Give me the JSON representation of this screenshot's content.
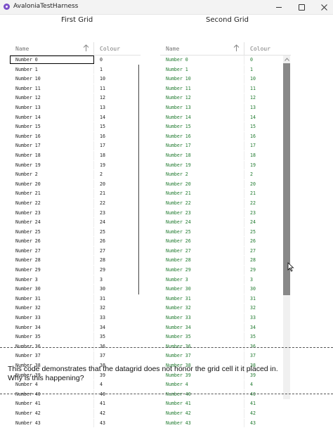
{
  "window": {
    "title": "AvaloniaTestHarness"
  },
  "grid1": {
    "title": "First Grid",
    "header": {
      "name": "Name",
      "colour": "Colour"
    },
    "rows": [
      {
        "name": "Number 0",
        "colour": "0"
      },
      {
        "name": "Number 1",
        "colour": "1"
      },
      {
        "name": "Number 10",
        "colour": "10"
      },
      {
        "name": "Number 11",
        "colour": "11"
      },
      {
        "name": "Number 12",
        "colour": "12"
      },
      {
        "name": "Number 13",
        "colour": "13"
      },
      {
        "name": "Number 14",
        "colour": "14"
      },
      {
        "name": "Number 15",
        "colour": "15"
      },
      {
        "name": "Number 16",
        "colour": "16"
      },
      {
        "name": "Number 17",
        "colour": "17"
      },
      {
        "name": "Number 18",
        "colour": "18"
      },
      {
        "name": "Number 19",
        "colour": "19"
      },
      {
        "name": "Number 2",
        "colour": "2"
      },
      {
        "name": "Number 20",
        "colour": "20"
      },
      {
        "name": "Number 21",
        "colour": "21"
      },
      {
        "name": "Number 22",
        "colour": "22"
      },
      {
        "name": "Number 23",
        "colour": "23"
      },
      {
        "name": "Number 24",
        "colour": "24"
      },
      {
        "name": "Number 25",
        "colour": "25"
      },
      {
        "name": "Number 26",
        "colour": "26"
      },
      {
        "name": "Number 27",
        "colour": "27"
      },
      {
        "name": "Number 28",
        "colour": "28"
      },
      {
        "name": "Number 29",
        "colour": "29"
      },
      {
        "name": "Number 3",
        "colour": "3"
      },
      {
        "name": "Number 30",
        "colour": "30"
      },
      {
        "name": "Number 31",
        "colour": "31"
      },
      {
        "name": "Number 32",
        "colour": "32"
      },
      {
        "name": "Number 33",
        "colour": "33"
      },
      {
        "name": "Number 34",
        "colour": "34"
      },
      {
        "name": "Number 35",
        "colour": "35"
      },
      {
        "name": "Number 36",
        "colour": "36"
      },
      {
        "name": "Number 37",
        "colour": "37"
      },
      {
        "name": "Number 38",
        "colour": "38"
      },
      {
        "name": "Number 39",
        "colour": "39"
      },
      {
        "name": "Number 4",
        "colour": "4"
      },
      {
        "name": "Number 40",
        "colour": "40"
      },
      {
        "name": "Number 41",
        "colour": "41"
      },
      {
        "name": "Number 42",
        "colour": "42"
      },
      {
        "name": "Number 43",
        "colour": "43"
      }
    ]
  },
  "grid2": {
    "title": "Second Grid",
    "header": {
      "name": "Name",
      "colour": "Colour"
    },
    "rows": [
      {
        "name": "Number 0",
        "colour": "0"
      },
      {
        "name": "Number 1",
        "colour": "1"
      },
      {
        "name": "Number 10",
        "colour": "10"
      },
      {
        "name": "Number 11",
        "colour": "11"
      },
      {
        "name": "Number 12",
        "colour": "12"
      },
      {
        "name": "Number 13",
        "colour": "13"
      },
      {
        "name": "Number 14",
        "colour": "14"
      },
      {
        "name": "Number 15",
        "colour": "15"
      },
      {
        "name": "Number 16",
        "colour": "16"
      },
      {
        "name": "Number 17",
        "colour": "17"
      },
      {
        "name": "Number 18",
        "colour": "18"
      },
      {
        "name": "Number 19",
        "colour": "19"
      },
      {
        "name": "Number 2",
        "colour": "2"
      },
      {
        "name": "Number 20",
        "colour": "20"
      },
      {
        "name": "Number 21",
        "colour": "21"
      },
      {
        "name": "Number 22",
        "colour": "22"
      },
      {
        "name": "Number 23",
        "colour": "23"
      },
      {
        "name": "Number 24",
        "colour": "24"
      },
      {
        "name": "Number 25",
        "colour": "25"
      },
      {
        "name": "Number 26",
        "colour": "26"
      },
      {
        "name": "Number 27",
        "colour": "27"
      },
      {
        "name": "Number 28",
        "colour": "28"
      },
      {
        "name": "Number 29",
        "colour": "29"
      },
      {
        "name": "Number 3",
        "colour": "3"
      },
      {
        "name": "Number 30",
        "colour": "30"
      },
      {
        "name": "Number 31",
        "colour": "31"
      },
      {
        "name": "Number 32",
        "colour": "32"
      },
      {
        "name": "Number 33",
        "colour": "33"
      },
      {
        "name": "Number 34",
        "colour": "34"
      },
      {
        "name": "Number 35",
        "colour": "35"
      },
      {
        "name": "Number 36",
        "colour": "36"
      },
      {
        "name": "Number 37",
        "colour": "37"
      },
      {
        "name": "Number 38",
        "colour": "38"
      },
      {
        "name": "Number 39",
        "colour": "39"
      },
      {
        "name": "Number 4",
        "colour": "4"
      },
      {
        "name": "Number 40",
        "colour": "40"
      },
      {
        "name": "Number 41",
        "colour": "41"
      },
      {
        "name": "Number 42",
        "colour": "42"
      },
      {
        "name": "Number 43",
        "colour": "43"
      }
    ]
  },
  "message": {
    "line1": "This code demonstrates that the datagrid does not honor the grid cell it it placed in.",
    "line2": "Why is this happening?"
  },
  "icons": {
    "sort": "sort-ascending-arrow-icon",
    "app": "avalonia-app-icon",
    "scroll_up": "chevron-up-icon",
    "cursor": "mouse-cursor-icon"
  },
  "colors": {
    "cell_text_green": "#1f7a2e",
    "scroll_thumb": "#888888"
  }
}
